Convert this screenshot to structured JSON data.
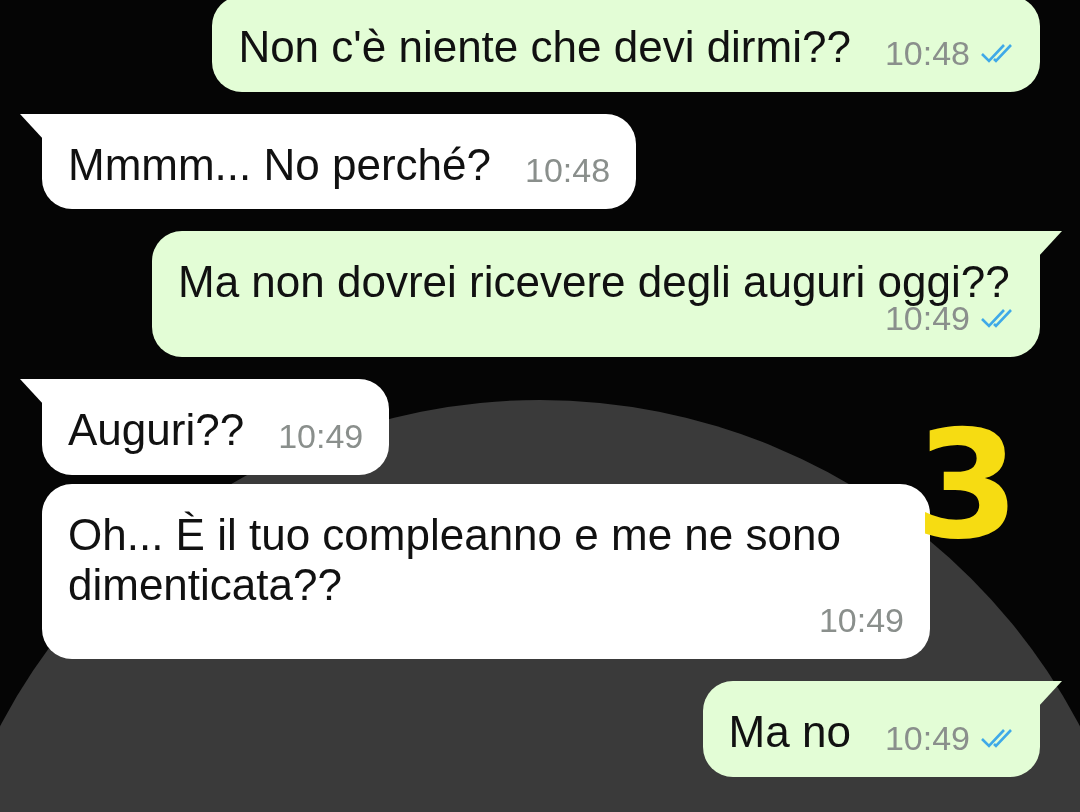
{
  "messages": [
    {
      "kind": "outgoing",
      "text": "Non c'è niente che devi dirmi??",
      "time": "10:48",
      "read": true,
      "tail": false
    },
    {
      "kind": "incoming",
      "text": "Mmmm... No perché?",
      "time": "10:48",
      "tail": true
    },
    {
      "kind": "outgoing",
      "text": "Ma non dovrei ricevere degli auguri oggi??",
      "time": "10:49",
      "read": true,
      "tail": true
    },
    {
      "kind": "incoming",
      "text": "Auguri??",
      "time": "10:49",
      "tail": true
    },
    {
      "kind": "incoming",
      "text": "Oh... È il tuo compleanno e me ne sono dimenticata??",
      "time": "10:49",
      "tail": false
    },
    {
      "kind": "outgoing",
      "text": "Ma no",
      "time": "10:49",
      "read": true,
      "tail": true
    }
  ],
  "annotation": {
    "text": "3"
  }
}
